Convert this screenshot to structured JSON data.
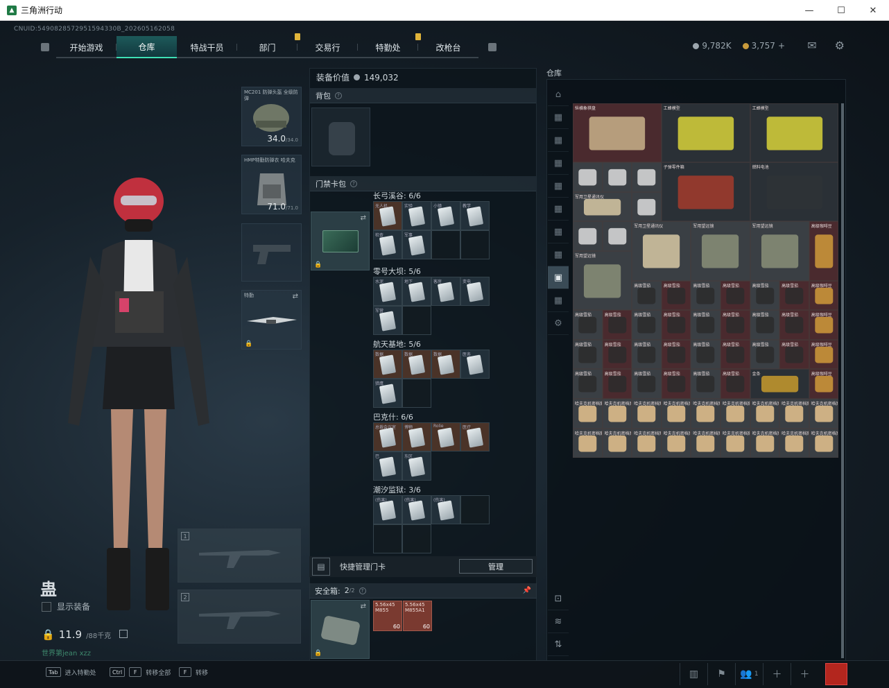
{
  "window": {
    "title": "三角洲行动",
    "min": "—",
    "max": "☐",
    "close": "✕"
  },
  "uid": "CNUID:5490828572951594330B_202605162058",
  "nav": {
    "tabs": [
      "开始游戏",
      "仓库",
      "特战干员",
      "部门",
      "交易行",
      "特勤处",
      "改枪台"
    ],
    "active": "仓库"
  },
  "currency": {
    "silver": "9,782K",
    "gold": "3,757",
    "plus": "+"
  },
  "character": {
    "name": "蛊",
    "show_gear": "显示装备",
    "weight": "11.9",
    "weight_max": "/88千克",
    "player_id": "世界第jean xzz"
  },
  "equipment": {
    "helmet": {
      "label": "MC201 防弹头盔 全级防弹",
      "dur": "34.0",
      "dur_max": "/34.0"
    },
    "armor": {
      "label": "HMP特勤防弹衣 哈夫克",
      "dur": "71.0",
      "dur_max": "/71.0"
    },
    "melee": {
      "label": "特勤"
    },
    "weapon_slots": [
      "1",
      "2"
    ]
  },
  "middle": {
    "value_label": "装备价值",
    "value": "149,032",
    "backpack": "背包",
    "keycard_bag": "门禁卡包",
    "q": "?",
    "maps": [
      {
        "name": "长弓溪谷: 6/6",
        "cards": [
          {
            "t": "无人机",
            "c": "brown"
          },
          {
            "t": "实验",
            "c": ""
          },
          {
            "t": "小镇",
            "c": ""
          },
          {
            "t": "教学",
            "c": ""
          },
          {
            "t": "检查",
            "c": ""
          },
          {
            "t": "军事",
            "c": ""
          },
          {
            "t": "",
            "c": "empty"
          },
          {
            "t": "",
            "c": "empty"
          }
        ]
      },
      {
        "name": "零号大坝: 5/6",
        "cards": [
          {
            "t": "水泥",
            "c": ""
          },
          {
            "t": "地下",
            "c": ""
          },
          {
            "t": "客房",
            "c": ""
          },
          {
            "t": "变电",
            "c": ""
          },
          {
            "t": "军营",
            "c": ""
          },
          {
            "t": "",
            "c": "empty"
          }
        ]
      },
      {
        "name": "航天基地: 5/6",
        "cards": [
          {
            "t": "数据",
            "c": "brown"
          },
          {
            "t": "数据",
            "c": "brown"
          },
          {
            "t": "数据",
            "c": "brown"
          },
          {
            "t": "医务",
            "c": ""
          },
          {
            "t": "猎鹰",
            "c": ""
          },
          {
            "t": "",
            "c": "empty"
          }
        ]
      },
      {
        "name": "巴克什: 6/6",
        "cards": [
          {
            "t": "总裁会议室",
            "c": "brown"
          },
          {
            "t": "博物",
            "c": "brown"
          },
          {
            "t": "Rolie",
            "c": "brown"
          },
          {
            "t": "医疗",
            "c": "brown"
          },
          {
            "t": "巴",
            "c": ""
          },
          {
            "t": "东区",
            "c": ""
          }
        ]
      },
      {
        "name": "潮汐监狱: 3/6",
        "cards": [
          {
            "t": "(伤害)",
            "c": ""
          },
          {
            "t": "(伤害)",
            "c": ""
          },
          {
            "t": "(伤害)",
            "c": ""
          },
          {
            "t": "",
            "c": "empty"
          },
          {
            "t": "",
            "c": "empty"
          },
          {
            "t": "",
            "c": "empty"
          }
        ]
      }
    ],
    "quick_label": "快捷管理门卡",
    "manage": "管理",
    "safe_label": "安全箱:",
    "safe_count": "2",
    "safe_max": "/2",
    "ammo": [
      {
        "t": "5.56x45 M855",
        "n": "60"
      },
      {
        "t": "5.56x45 M855A1",
        "n": "60"
      }
    ]
  },
  "stash": {
    "title": "仓库",
    "items": {
      "chess": "纵横象棋盘",
      "bee1": "工蜂模型",
      "bee2": "工蜂模型",
      "ammo_box": "子弹零件箱",
      "fuel": "燃料电池",
      "sat1": "军用卫星通讯仪",
      "sat2": "军用卫星通讯仪",
      "bino1": "军用望远镜",
      "bino2": "军用望远镜",
      "bino3": "军用望远镜",
      "coffee": "高级咖啡豆",
      "cigar": "高级咖啡豆",
      "cigar_box": "高级雪茄",
      "gold": "金条",
      "hafk": "哈夫克机密档案",
      "boxes": "高级咖啡豆"
    }
  },
  "bottom": {
    "hints": [
      {
        "k": "Tab",
        "t": "进入特勤处"
      },
      {
        "k": "Ctrl",
        "k2": "F",
        "t": "转移全部"
      },
      {
        "k": "F",
        "t": "转移"
      }
    ],
    "friends": "1"
  },
  "colors": {
    "accent": "#3ee0b5",
    "badge": "#e0b43a"
  }
}
